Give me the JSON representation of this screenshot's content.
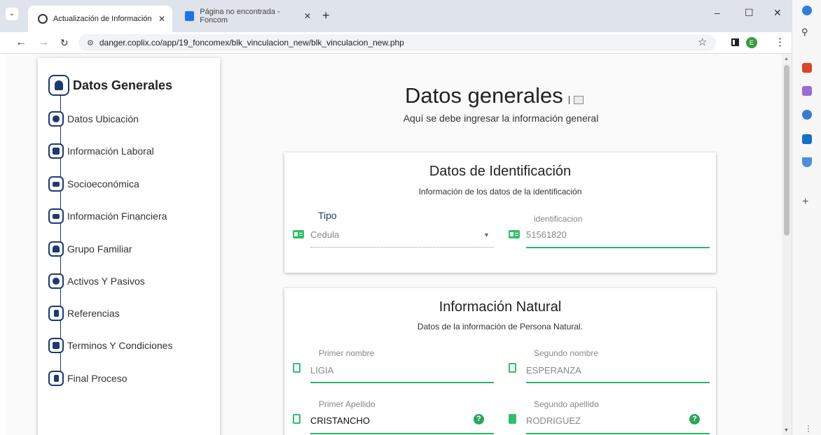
{
  "browser": {
    "tabs": [
      {
        "title": "Actualización de Información",
        "close": "✕"
      },
      {
        "title": "Página no encontrada - Foncom",
        "close": "✕"
      }
    ],
    "new_tab": "+",
    "url": "danger.coplix.co/app/19_foncomex/blk_vinculacion_new/blk_vinculacion_new.php",
    "profile_initial": "E",
    "window_controls": [
      "–",
      "☐",
      "✕"
    ],
    "edge_plus": "+"
  },
  "stepper": {
    "steps": [
      {
        "label": "Datos Generales",
        "icon": "user-icon"
      },
      {
        "label": "Datos Ubicación",
        "icon": "search-location-icon"
      },
      {
        "label": "Información Laboral",
        "icon": "briefcase-icon"
      },
      {
        "label": "Socioeconómica",
        "icon": "credit-card-icon"
      },
      {
        "label": "Información Financiera",
        "icon": "credit-card-icon"
      },
      {
        "label": "Grupo Familiar",
        "icon": "users-icon"
      },
      {
        "label": "Activos Y Pasivos",
        "icon": "money-icon"
      },
      {
        "label": "Referencias",
        "icon": "contact-card-icon"
      },
      {
        "label": "Terminos Y Condiciones",
        "icon": "wallet-icon"
      },
      {
        "label": "Final Proceso",
        "icon": "contact-card-icon"
      }
    ]
  },
  "main": {
    "title": "Datos generales",
    "subtitle": "Aquí se debe ingresar la información general"
  },
  "identificacion": {
    "title": "Datos de Identificación",
    "subtitle": "Información de los datos de la identificación",
    "tipo_label": "Tipo",
    "tipo_value": "Cedula",
    "id_label": "identificacion",
    "id_value": "51561820"
  },
  "natural": {
    "title": "Información Natural",
    "subtitle": "Datos de la información de Persona Natural.",
    "primer_nombre_label": "Primer nombre",
    "primer_nombre_value": "LIGIA",
    "segundo_nombre_label": "Segundo nombre",
    "segundo_nombre_value": "ESPERANZA",
    "primer_apellido_label": "Primer Apellido",
    "primer_apellido_value": "CRISTANCHO",
    "segundo_apellido_label": "Segundo apellido",
    "segundo_apellido_value": "RODRIGUEZ",
    "help": "?"
  },
  "colors": {
    "accent": "#1b3a70",
    "green": "#2db46b"
  }
}
